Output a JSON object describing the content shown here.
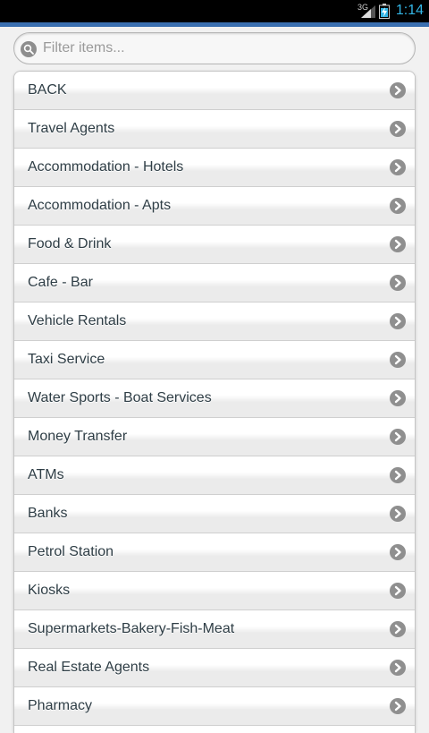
{
  "status_bar": {
    "network": "3G",
    "time": "1:14"
  },
  "search": {
    "placeholder": "Filter items...",
    "value": ""
  },
  "list": {
    "items": [
      {
        "label": "BACK"
      },
      {
        "label": "Travel Agents"
      },
      {
        "label": "Accommodation - Hotels"
      },
      {
        "label": "Accommodation - Apts"
      },
      {
        "label": "Food & Drink"
      },
      {
        "label": "Cafe - Bar"
      },
      {
        "label": "Vehicle Rentals"
      },
      {
        "label": "Taxi Service"
      },
      {
        "label": "Water Sports - Boat Services"
      },
      {
        "label": "Money Transfer"
      },
      {
        "label": "ATMs"
      },
      {
        "label": "Banks"
      },
      {
        "label": "Petrol Station"
      },
      {
        "label": "Kiosks"
      },
      {
        "label": "Supermarkets-Bakery-Fish-Meat"
      },
      {
        "label": "Real Estate Agents"
      },
      {
        "label": "Pharmacy"
      }
    ]
  },
  "icons": {
    "search": "search-icon",
    "item_arrow": "chevron-right-icon"
  },
  "colors": {
    "accent_bar": "#3a6fb0",
    "clock": "#33b5e5",
    "item_text": "#2f3e46",
    "arrow_bg": "#8f8f8f"
  }
}
